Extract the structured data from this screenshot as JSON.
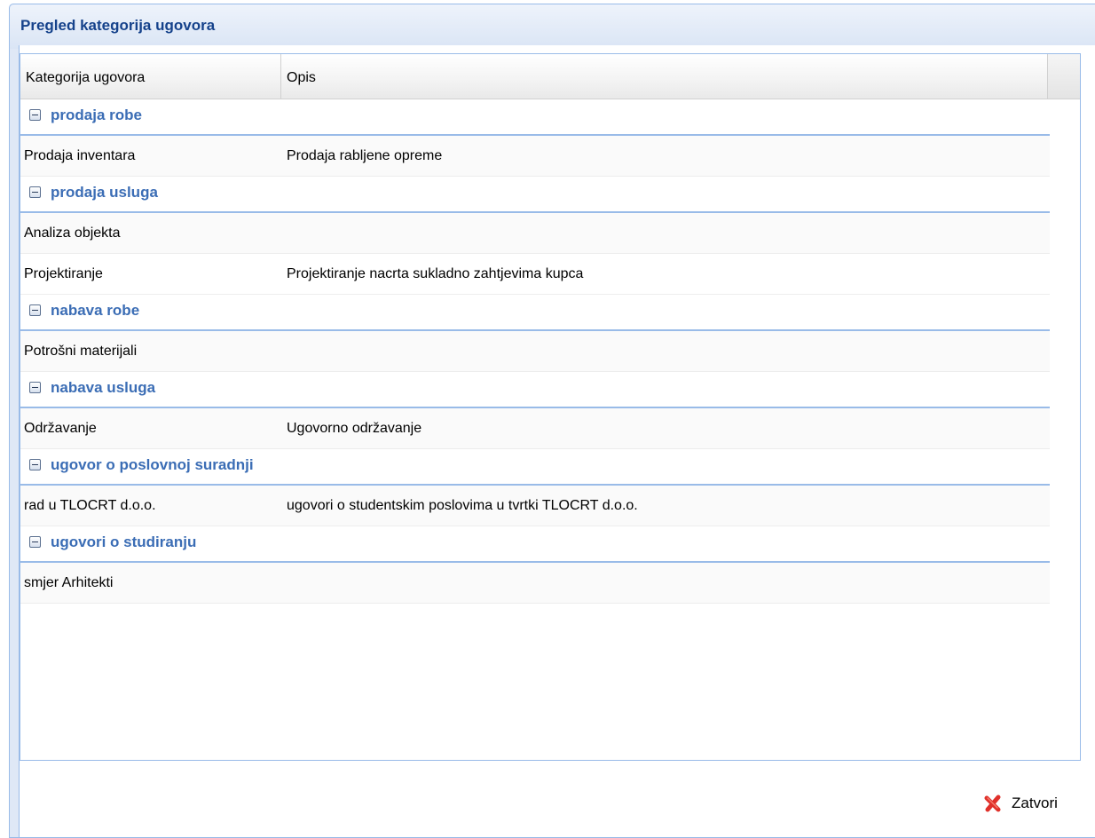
{
  "window": {
    "title": "Pregled kategorija ugovora"
  },
  "grid": {
    "columns": [
      "Kategorija ugovora",
      "Opis"
    ],
    "groups": [
      {
        "name": "prodaja robe",
        "rows": [
          {
            "category": "Prodaja inventara",
            "description": "Prodaja rabljene opreme"
          }
        ]
      },
      {
        "name": "prodaja usluga",
        "rows": [
          {
            "category": "Analiza objekta",
            "description": ""
          },
          {
            "category": "Projektiranje",
            "description": "Projektiranje nacrta sukladno zahtjevima kupca"
          }
        ]
      },
      {
        "name": "nabava robe",
        "rows": [
          {
            "category": "Potrošni materijali",
            "description": ""
          }
        ]
      },
      {
        "name": "nabava usluga",
        "rows": [
          {
            "category": "Održavanje",
            "description": "Ugovorno održavanje"
          }
        ]
      },
      {
        "name": "ugovor o poslovnoj suradnji",
        "rows": [
          {
            "category": "rad u TLOCRT d.o.o.",
            "description": "ugovori o studentskim poslovima u tvrtki TLOCRT d.o.o."
          }
        ]
      },
      {
        "name": "ugovori o studiranju",
        "rows": [
          {
            "category": "smjer Arhitekti",
            "description": ""
          }
        ]
      }
    ]
  },
  "footer": {
    "close_label": "Zatvori",
    "close_icon": "close-x-icon",
    "close_icon_color": "#e0302a"
  },
  "colors": {
    "title": "#15428b",
    "group_label": "#3b6db5",
    "border": "#99bbe8"
  }
}
